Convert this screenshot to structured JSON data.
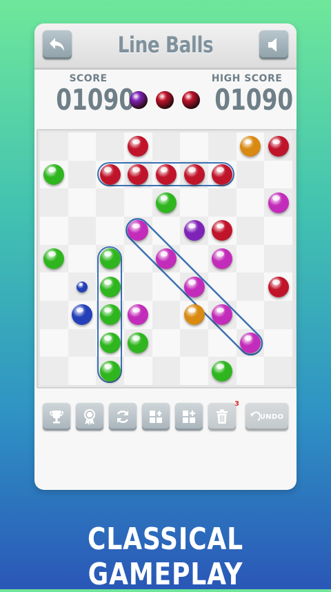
{
  "header": {
    "title": "Line Balls",
    "back_icon": "back-arrow-icon",
    "sound_icon": "speaker-icon"
  },
  "score": {
    "label": "SCORE",
    "value": "01090"
  },
  "high_score": {
    "label": "HIGH SCORE",
    "value": "01090"
  },
  "next_balls": [
    "purple",
    "red",
    "red"
  ],
  "colors": {
    "red": "#c0142a",
    "green": "#2fb61f",
    "purple": "#7f23b8",
    "magenta": "#c32cba",
    "orange": "#d98a12",
    "blue": "#2340b8",
    "outline": "#3a6fb4"
  },
  "board": {
    "rows": 9,
    "cols": 9,
    "balls": [
      {
        "row": 0,
        "col": 3,
        "color": "red"
      },
      {
        "row": 0,
        "col": 7,
        "color": "orange"
      },
      {
        "row": 0,
        "col": 8,
        "color": "red"
      },
      {
        "row": 1,
        "col": 0,
        "color": "green"
      },
      {
        "row": 1,
        "col": 2,
        "color": "red"
      },
      {
        "row": 1,
        "col": 3,
        "color": "red"
      },
      {
        "row": 1,
        "col": 4,
        "color": "red"
      },
      {
        "row": 1,
        "col": 5,
        "color": "red"
      },
      {
        "row": 1,
        "col": 6,
        "color": "red"
      },
      {
        "row": 2,
        "col": 4,
        "color": "green"
      },
      {
        "row": 2,
        "col": 8,
        "color": "magenta"
      },
      {
        "row": 3,
        "col": 3,
        "color": "magenta"
      },
      {
        "row": 3,
        "col": 5,
        "color": "purple"
      },
      {
        "row": 3,
        "col": 6,
        "color": "red"
      },
      {
        "row": 4,
        "col": 0,
        "color": "green"
      },
      {
        "row": 4,
        "col": 2,
        "color": "green"
      },
      {
        "row": 4,
        "col": 4,
        "color": "magenta"
      },
      {
        "row": 4,
        "col": 6,
        "color": "magenta"
      },
      {
        "row": 5,
        "col": 1,
        "color": "blue",
        "small": true
      },
      {
        "row": 5,
        "col": 2,
        "color": "green"
      },
      {
        "row": 5,
        "col": 5,
        "color": "magenta"
      },
      {
        "row": 5,
        "col": 8,
        "color": "red"
      },
      {
        "row": 6,
        "col": 1,
        "color": "blue"
      },
      {
        "row": 6,
        "col": 2,
        "color": "green"
      },
      {
        "row": 6,
        "col": 3,
        "color": "magenta"
      },
      {
        "row": 6,
        "col": 5,
        "color": "orange"
      },
      {
        "row": 6,
        "col": 6,
        "color": "magenta"
      },
      {
        "row": 7,
        "col": 2,
        "color": "green"
      },
      {
        "row": 7,
        "col": 3,
        "color": "green"
      },
      {
        "row": 7,
        "col": 7,
        "color": "magenta"
      },
      {
        "row": 8,
        "col": 2,
        "color": "green"
      },
      {
        "row": 8,
        "col": 6,
        "color": "green"
      }
    ]
  },
  "toolbar": {
    "buttons": [
      {
        "name": "trophy-button",
        "icon": "trophy-icon"
      },
      {
        "name": "achievements-button",
        "icon": "medal-icon"
      },
      {
        "name": "restart-button",
        "icon": "refresh-icon"
      },
      {
        "name": "move-up-button",
        "icon": "grid-up-icon"
      },
      {
        "name": "add-button",
        "icon": "grid-add-icon"
      },
      {
        "name": "trash-button",
        "icon": "trash-icon"
      }
    ],
    "trash_badge": "3",
    "undo_label": "UNDO"
  },
  "caption": "CLASSICAL GAMEPLAY"
}
